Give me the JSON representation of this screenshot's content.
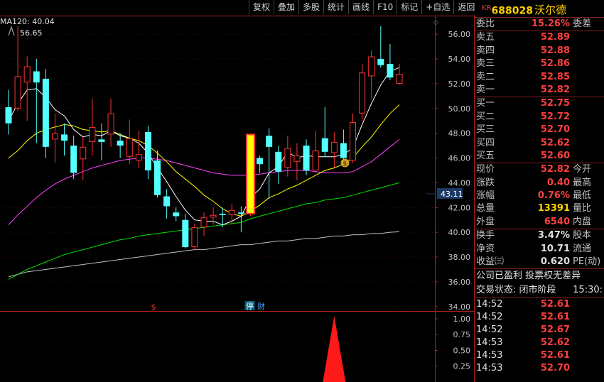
{
  "toolbar": [
    "复权",
    "叠加",
    "多股",
    "统计",
    "画线",
    "F10",
    "标记",
    "+自选",
    "返回"
  ],
  "ma_label": "MA120: 40.04",
  "high_label": "56.65",
  "markers": {
    "dollar": "$",
    "ting": "停",
    "cai": "财"
  },
  "price_tag": "43.11",
  "colors": {
    "up": "#ff3232",
    "down": "#54ffff",
    "ma5": "#ffffff",
    "ma10": "#ffff00",
    "ma20": "#ff40ff",
    "ma60": "#00e000",
    "ma120": "#c0c0c0",
    "highlight": "#ffff00"
  },
  "chart_data": {
    "type": "candlestick",
    "y_ticks": [
      "56.00",
      "54.00",
      "52.00",
      "50.00",
      "48.00",
      "46.00",
      "44.00",
      "42.00",
      "40.00",
      "38.00",
      "36.00",
      "34.00"
    ],
    "ylim": [
      33.7,
      57.5
    ],
    "sub_ticks": [
      "1.00",
      "0.75",
      "0.50",
      "0.25"
    ],
    "sub_ylim": [
      0,
      1.1
    ],
    "candles": [
      {
        "o": 50.1,
        "c": 48.8,
        "h": 51.5,
        "l": 47.9
      },
      {
        "o": 50.0,
        "c": 52.6,
        "h": 56.65,
        "l": 49.8
      },
      {
        "o": 52.1,
        "c": 53.4,
        "h": 54.2,
        "l": 49.0
      },
      {
        "o": 53.0,
        "c": 52.1,
        "h": 54.0,
        "l": 47.2
      },
      {
        "o": 52.4,
        "c": 46.9,
        "h": 53.2,
        "l": 46.0
      },
      {
        "o": 47.5,
        "c": 48.0,
        "h": 49.6,
        "l": 45.6
      },
      {
        "o": 47.9,
        "c": 47.4,
        "h": 48.8,
        "l": 46.2
      },
      {
        "o": 47.0,
        "c": 44.8,
        "h": 47.8,
        "l": 44.3
      },
      {
        "o": 45.9,
        "c": 46.9,
        "h": 47.7,
        "l": 44.2
      },
      {
        "o": 47.3,
        "c": 48.5,
        "h": 50.8,
        "l": 46.2
      },
      {
        "o": 47.5,
        "c": 47.3,
        "h": 48.8,
        "l": 45.8
      },
      {
        "o": 47.9,
        "c": 49.6,
        "h": 50.8,
        "l": 46.9
      },
      {
        "o": 47.4,
        "c": 47.0,
        "h": 48.0,
        "l": 46.0
      },
      {
        "o": 46.1,
        "c": 47.6,
        "h": 49.1,
        "l": 45.5
      },
      {
        "o": 45.8,
        "c": 46.3,
        "h": 48.2,
        "l": 45.2
      },
      {
        "o": 48.1,
        "c": 45.0,
        "h": 48.6,
        "l": 44.3
      },
      {
        "o": 45.8,
        "c": 43.0,
        "h": 46.6,
        "l": 42.8
      },
      {
        "o": 42.9,
        "c": 42.1,
        "h": 43.5,
        "l": 41.1
      },
      {
        "o": 41.6,
        "c": 41.3,
        "h": 42.0,
        "l": 40.9
      },
      {
        "o": 41.0,
        "c": 38.8,
        "h": 41.5,
        "l": 38.7
      },
      {
        "o": 38.8,
        "c": 40.4,
        "h": 40.7,
        "l": 38.6
      },
      {
        "o": 40.4,
        "c": 41.2,
        "h": 41.6,
        "l": 39.7
      },
      {
        "o": 41.2,
        "c": 41.4,
        "h": 42.0,
        "l": 40.6
      },
      {
        "o": 41.5,
        "c": 41.4,
        "h": 42.0,
        "l": 40.4
      },
      {
        "o": 41.4,
        "c": 41.8,
        "h": 42.3,
        "l": 40.6
      },
      {
        "o": 41.6,
        "c": 41.5,
        "h": 42.1,
        "l": 40.0
      },
      {
        "o": 41.5,
        "c": 47.9,
        "h": 47.9,
        "l": 41.3
      },
      {
        "o": 46.0,
        "c": 45.5,
        "h": 46.2,
        "l": 44.8
      },
      {
        "o": 47.8,
        "c": 46.9,
        "h": 48.4,
        "l": 42.7
      },
      {
        "o": 46.5,
        "c": 44.9,
        "h": 47.0,
        "l": 43.9
      },
      {
        "o": 45.2,
        "c": 46.8,
        "h": 47.8,
        "l": 44.5
      },
      {
        "o": 45.7,
        "c": 46.2,
        "h": 47.2,
        "l": 44.2
      },
      {
        "o": 47.0,
        "c": 45.0,
        "h": 47.5,
        "l": 44.6
      },
      {
        "o": 45.0,
        "c": 46.6,
        "h": 48.2,
        "l": 44.8
      },
      {
        "o": 47.6,
        "c": 46.5,
        "h": 50.1,
        "l": 46.1
      },
      {
        "o": 46.4,
        "c": 47.3,
        "h": 48.1,
        "l": 45.2
      },
      {
        "o": 47.2,
        "c": 46.0,
        "h": 48.3,
        "l": 45.7
      },
      {
        "o": 45.8,
        "c": 48.9,
        "h": 49.6,
        "l": 45.6
      },
      {
        "o": 49.6,
        "c": 52.9,
        "h": 53.6,
        "l": 49.0
      },
      {
        "o": 52.6,
        "c": 54.2,
        "h": 54.7,
        "l": 50.8
      },
      {
        "o": 54.0,
        "c": 53.5,
        "h": 56.65,
        "l": 53.3
      },
      {
        "o": 53.6,
        "c": 52.5,
        "h": 55.2,
        "l": 52.3
      },
      {
        "o": 52.0,
        "c": 52.8,
        "h": 53.6,
        "l": 51.9
      }
    ],
    "ma5": [
      49.0,
      50.4,
      51.5,
      51.6,
      50.9,
      49.9,
      49.4,
      48.3,
      47.7,
      47.9,
      47.8,
      48.2,
      47.8,
      47.6,
      47.2,
      46.4,
      45.2,
      44.1,
      42.9,
      41.8,
      41.0,
      40.9,
      40.9,
      40.6,
      40.9,
      41.3,
      42.8,
      43.5,
      44.8,
      45.3,
      46.5,
      46.0,
      46.2,
      46.1,
      46.1,
      46.1,
      46.3,
      46.8,
      48.7,
      50.4,
      51.9,
      53.0,
      53.3
    ],
    "ma10": [
      46.0,
      46.6,
      47.4,
      48.0,
      48.3,
      48.5,
      48.7,
      48.6,
      48.3,
      48.2,
      48.1,
      48.2,
      47.9,
      47.6,
      47.4,
      47.0,
      46.4,
      45.7,
      44.9,
      44.3,
      43.7,
      43.0,
      42.5,
      41.9,
      41.5,
      41.3,
      41.7,
      42.2,
      42.8,
      43.1,
      43.5,
      43.8,
      44.2,
      44.6,
      45.0,
      45.2,
      45.5,
      46.0,
      46.9,
      47.7,
      48.7,
      49.6,
      50.3
    ],
    "ma20": [
      40.6,
      41.4,
      42.1,
      42.8,
      43.4,
      43.9,
      44.3,
      44.6,
      44.9,
      45.2,
      45.4,
      45.6,
      45.8,
      45.9,
      46.0,
      46.0,
      45.9,
      45.8,
      45.6,
      45.4,
      45.2,
      45.0,
      44.8,
      44.7,
      44.6,
      44.6,
      44.6,
      44.7,
      44.8,
      44.9,
      45.0,
      45.0,
      45.0,
      44.9,
      44.8,
      44.8,
      44.8,
      44.9,
      45.3,
      45.7,
      46.3,
      46.9,
      47.5
    ],
    "ma60": [
      36.2,
      36.6,
      37.0,
      37.3,
      37.6,
      37.9,
      38.2,
      38.4,
      38.6,
      38.8,
      39.0,
      39.2,
      39.4,
      39.5,
      39.7,
      39.8,
      39.9,
      40.0,
      40.1,
      40.2,
      40.3,
      40.4,
      40.5,
      40.6,
      40.7,
      40.8,
      41.1,
      41.3,
      41.5,
      41.7,
      41.9,
      42.1,
      42.3,
      42.4,
      42.6,
      42.7,
      42.8,
      43.0,
      43.2,
      43.4,
      43.6,
      43.8,
      44.0
    ],
    "ma120": [
      36.4,
      36.6,
      36.8,
      36.9,
      37.0,
      37.1,
      37.2,
      37.3,
      37.4,
      37.5,
      37.6,
      37.7,
      37.8,
      37.9,
      38.0,
      38.1,
      38.2,
      38.3,
      38.4,
      38.5,
      38.6,
      38.6,
      38.7,
      38.8,
      38.9,
      39.0,
      39.0,
      39.1,
      39.2,
      39.3,
      39.3,
      39.4,
      39.5,
      39.5,
      39.6,
      39.7,
      39.7,
      39.8,
      39.8,
      39.9,
      39.9,
      40.0,
      40.04
    ],
    "highlight_index": 26,
    "sub_signal": {
      "index": 35,
      "value": 1.0
    }
  },
  "panel": {
    "kr": "KR",
    "code": "688028",
    "name": "沃尔德",
    "wei": {
      "l": "委比",
      "v": "15.26%",
      "r": "委差"
    },
    "sells": [
      {
        "l": "卖五",
        "v": "52.89"
      },
      {
        "l": "卖四",
        "v": "52.88"
      },
      {
        "l": "卖三",
        "v": "52.86"
      },
      {
        "l": "卖二",
        "v": "52.85"
      },
      {
        "l": "卖一",
        "v": "52.82"
      }
    ],
    "buys": [
      {
        "l": "买一",
        "v": "52.75"
      },
      {
        "l": "买二",
        "v": "52.72"
      },
      {
        "l": "买三",
        "v": "52.70"
      },
      {
        "l": "买四",
        "v": "52.62"
      },
      {
        "l": "买五",
        "v": "52.60"
      }
    ],
    "quote": [
      {
        "l": "现价",
        "v": "52.82",
        "r": "今开",
        "c": "red"
      },
      {
        "l": "涨跌",
        "v": "0.40",
        "r": "最高",
        "c": "red"
      },
      {
        "l": "涨幅",
        "v": "0.76%",
        "r": "最低",
        "c": "red"
      },
      {
        "l": "总量",
        "v": "13391",
        "r": "量比",
        "c": "yel"
      },
      {
        "l": "外盘",
        "v": "6540",
        "r": "内盘",
        "c": "red"
      }
    ],
    "stats": [
      {
        "l": "换手",
        "v": "3.47%",
        "r": "股本",
        "c": "wht"
      },
      {
        "l": "净资",
        "v": "10.71",
        "r": "流通",
        "c": "wht"
      },
      {
        "l": "收益㈢",
        "v": "0.620",
        "r": "PE(动)",
        "c": "wht"
      }
    ],
    "notice": "公司已盈利 投票权无差异",
    "status_label": "交易状态: 闭市阶段",
    "status_time": "15:30:",
    "ticks": [
      {
        "t": "14:52",
        "p": "52.61"
      },
      {
        "t": "14:52",
        "p": "52.61"
      },
      {
        "t": "14:52",
        "p": "52.67"
      },
      {
        "t": "14:53",
        "p": "52.62"
      },
      {
        "t": "14:53",
        "p": "52.61"
      },
      {
        "t": "14:53",
        "p": "52.70"
      }
    ]
  }
}
